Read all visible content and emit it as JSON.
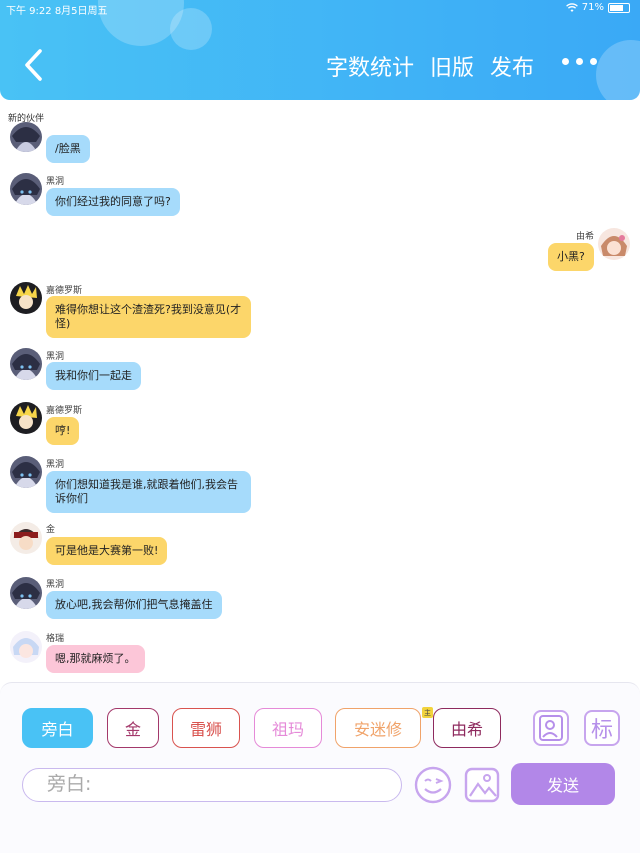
{
  "status": {
    "time_date": "下午 9:22   8月5日周五",
    "battery": "71%"
  },
  "header": {
    "word_count": "字数统计",
    "old_version": "旧版",
    "publish": "发布"
  },
  "chat_title": "新的伙伴",
  "messages": [
    {
      "name": "",
      "text": "/脸黑",
      "side": "left",
      "color": "blue",
      "avatar": "黑洞"
    },
    {
      "name": "黑洞",
      "text": "你们经过我的同意了吗?",
      "side": "left",
      "color": "blue",
      "avatar": "黑洞"
    },
    {
      "name": "由希",
      "text": "小黑?",
      "side": "right",
      "color": "yellow",
      "avatar": "由希"
    },
    {
      "name": "嘉德罗斯",
      "text": "难得你想让这个渣渣死?我到没意见(才怪)",
      "line1": "难得你想让这个渣渣死?我到没意见(才",
      "line2": "怪)",
      "side": "left",
      "color": "yellow",
      "avatar": "嘉德罗斯"
    },
    {
      "name": "黑洞",
      "text": "我和你们一起走",
      "side": "left",
      "color": "blue",
      "avatar": "黑洞"
    },
    {
      "name": "嘉德罗斯",
      "text": "哼!",
      "side": "left",
      "color": "yellow",
      "avatar": "嘉德罗斯"
    },
    {
      "name": "黑洞",
      "line1": "你们想知道我是谁,就跟着他们,我会告",
      "line2": "诉你们",
      "side": "left",
      "color": "blue",
      "avatar": "黑洞"
    },
    {
      "name": "金",
      "text": "可是他是大赛第一败!",
      "side": "left",
      "color": "yellow",
      "avatar": "金"
    },
    {
      "name": "黑洞",
      "text": "放心吧,我会帮你们把气息掩盖住",
      "side": "left",
      "color": "blue",
      "avatar": "黑洞"
    },
    {
      "name": "格瑞",
      "text": "嗯,那就麻烦了。",
      "side": "left",
      "color": "pink",
      "avatar": "格瑞"
    }
  ],
  "roles": [
    {
      "label": "旁白",
      "active": true,
      "color": "#49c2f5"
    },
    {
      "label": "金",
      "active": false,
      "color": "#a3386a"
    },
    {
      "label": "雷狮",
      "active": false,
      "color": "#d9534f"
    },
    {
      "label": "祖玛",
      "active": false,
      "color": "#e58ad8"
    },
    {
      "label": "安迷修",
      "active": false,
      "color": "#f0a36a"
    },
    {
      "label": "由希",
      "active": false,
      "color": "#8e2a5e"
    }
  ],
  "main_badge": "主",
  "tools": {
    "tag_label": "标"
  },
  "composer": {
    "placeholder": "旁白:",
    "send_label": "发送"
  }
}
